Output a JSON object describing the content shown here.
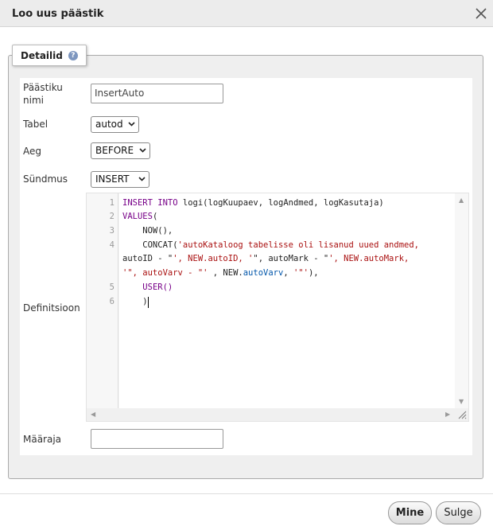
{
  "dialog": {
    "title": "Loo uus päästik"
  },
  "section": {
    "legend": "Detailid",
    "help_glyph": "?"
  },
  "form": {
    "name_label": "Päästiku nimi",
    "name_value": "InsertAuto",
    "table_label": "Tabel",
    "table_value": "autod",
    "time_label": "Aeg",
    "time_value": "BEFORE",
    "event_label": "Sündmus",
    "event_value": "INSERT",
    "definition_label": "Definitsioon",
    "definer_label": "Määraja",
    "definer_value": ""
  },
  "editor": {
    "line_numbers": [
      "1",
      "2",
      "3",
      "4",
      "5",
      "6"
    ],
    "lines": [
      "INSERT INTO logi(logKuupaev, logAndmed, logKasutaja)",
      "VALUES(",
      "    NOW(),",
      "    CONCAT('autoKataloog tabelisse oli lisanud uued andmed,",
      "autoID - \"', NEW.autoID, '\", autoMark - \"', NEW.autoMark,",
      "'\", autoVarv - \"' , NEW.autoVarv, '\"'),",
      "    USER()",
      "    )"
    ]
  },
  "buttons": {
    "go": "Mine",
    "close": "Sulge"
  },
  "colors": {
    "keyword": "#770088",
    "string": "#aa1111",
    "property": "#0055aa"
  }
}
